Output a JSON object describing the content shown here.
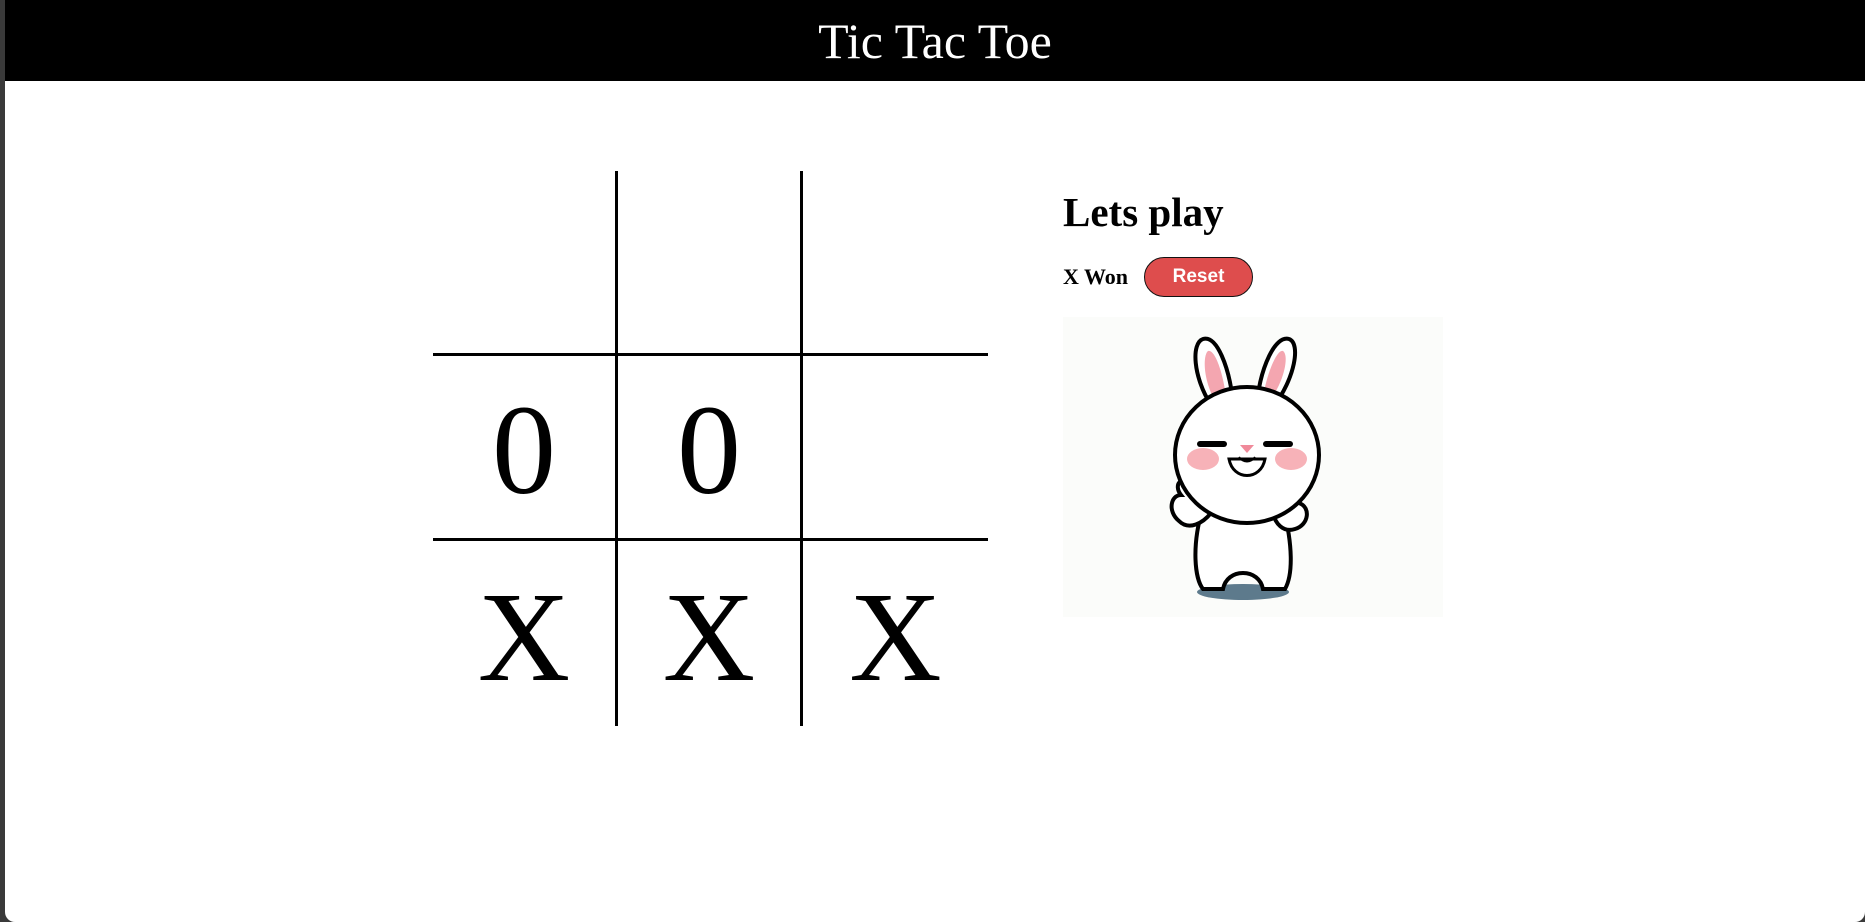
{
  "header": {
    "title": "Tic Tac Toe"
  },
  "board": {
    "cells": [
      "",
      "",
      "",
      "0",
      "0",
      "",
      "X",
      "X",
      "X"
    ]
  },
  "side": {
    "heading": "Lets play",
    "status": "X Won",
    "reset_label": "Reset"
  },
  "colors": {
    "header_bg": "#000000",
    "reset_bg": "#de4d4d",
    "bunny_ear": "#f4a6b0",
    "bunny_blush": "#f7b2b8"
  }
}
